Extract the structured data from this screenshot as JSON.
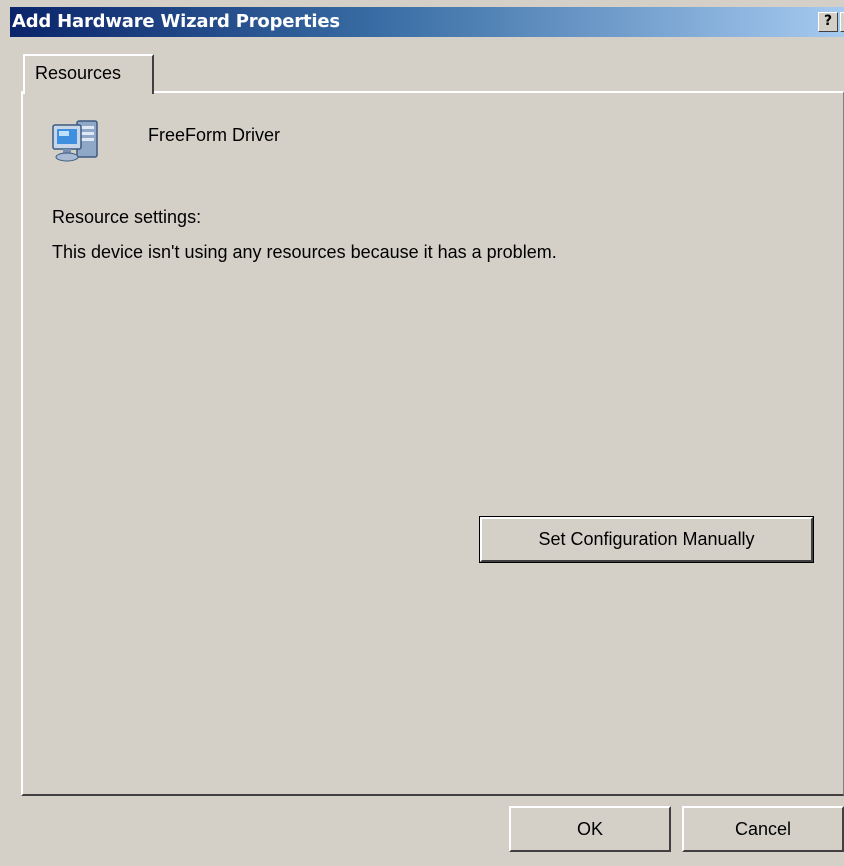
{
  "window": {
    "title": "Add Hardware Wizard Properties",
    "help_label": "?",
    "close_label": "×"
  },
  "tabs": [
    {
      "label": "Resources"
    }
  ],
  "device": {
    "icon": "computer-icon",
    "name": "FreeForm Driver"
  },
  "resources": {
    "settings_label": "Resource settings:",
    "message": "This device isn't using any resources because it has a problem.",
    "config_button_label": "Set Configuration Manually"
  },
  "footer": {
    "ok_label": "OK",
    "cancel_label": "Cancel"
  },
  "colors": {
    "title_bar_start": "#0a246a",
    "title_bar_end": "#a6caf0",
    "dialog_face": "#d4d0c8"
  }
}
